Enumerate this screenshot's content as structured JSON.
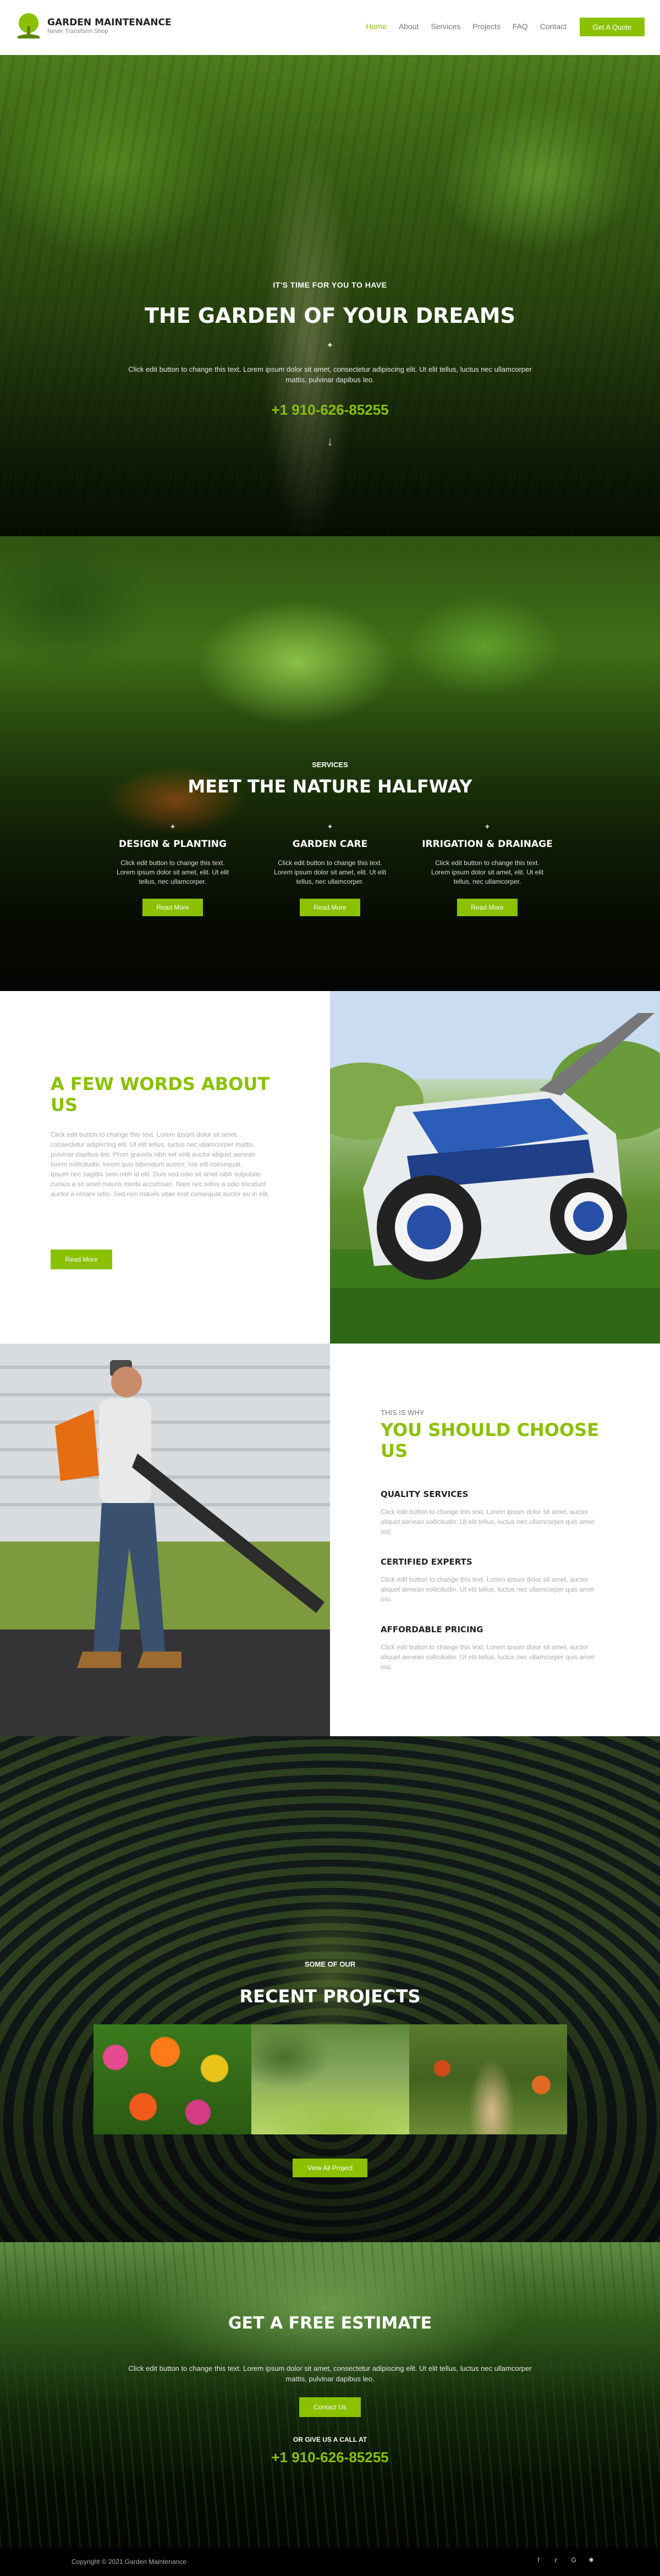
{
  "brand": {
    "name": "GARDEN MAINTENANCE",
    "tagline": "Never Transform Shop",
    "accent_color": "#8ac100",
    "logo_icon": "tree-icon"
  },
  "nav": {
    "items": [
      {
        "label": "Home",
        "active": true
      },
      {
        "label": "About",
        "active": false
      },
      {
        "label": "Services",
        "active": false
      },
      {
        "label": "Projects",
        "active": false
      },
      {
        "label": "FAQ",
        "active": false
      },
      {
        "label": "Contact",
        "active": false
      }
    ],
    "cta_label": "Get A Quote"
  },
  "hero": {
    "pre_title": "IT'S TIME FOR YOU TO HAVE",
    "title": "THE GARDEN OF YOUR DREAMS",
    "description": "Click edit button to change this text. Lorem ipsum dolor sit amet, consectetur adipiscing elit. Ut elit tellus, luctus nec ullamcorper mattis, pulvinar dapibus leo.",
    "phone": "+1 910-626-85255"
  },
  "services": {
    "pre_title": "SERVICES",
    "title": "MEET THE NATURE HALFWAY",
    "items": [
      {
        "title": "DESIGN & PLANTING",
        "text": "Click edit button to change this text. Lorem ipsum dolor sit amet, elit. Ut elit tellus, nec ullamcorper.",
        "button": "Read More"
      },
      {
        "title": "GARDEN CARE",
        "text": "Click edit button to change this text. Lorem ipsum dolor sit amet, elit. Ut elit tellus, nec ullamcorper.",
        "button": "Read More"
      },
      {
        "title": "IRRIGATION & DRAINAGE",
        "text": "Click edit button to change this text. Lorem ipsum dolor sit amet, elit. Ut elit tellus, nec ullamcorper.",
        "button": "Read More"
      }
    ]
  },
  "about": {
    "title": "A FEW WORDS ABOUT US",
    "paragraph_1": "Click edit button to change this text. Lorem ipsum dolor sit amet, consectetur adipiscing elit. Ut elit tellus, luctus nec ullamcorper mattis, pulvinar dapibus leo. Proin gravida nibh vel velit auctor aliquet aenean lorem sollicitudin, lorem quis bibendum auctor, nisi elit consequat.",
    "paragraph_2": "Ipsum nec sagittis sem nibh id elit. Duis sed odio sit amet nibh vulputate cursus a sit amet mauris morbi accumsan. Nam nec tellus a odio tincidunt auctor a ornare odio. Sed non mauris vitae erat consequat auctor eu in elit.",
    "button": "Read More"
  },
  "why": {
    "pre_title": "THIS IS WHY",
    "title": "YOU SHOULD CHOOSE US",
    "items": [
      {
        "title": "QUALITY SERVICES",
        "text": "Click edit button to change this text. Lorem ipsum dolor sit amet, auctor aliquet aenean sollicitudin. Ut elit tellus, luctus nec ullamcorper quis amet nisi."
      },
      {
        "title": "CERTIFIED EXPERTS",
        "text": "Click edit button to change this text. Lorem ipsum dolor sit amet, auctor aliquet aenean sollicitudin. Ut elit tellus, luctus nec ullamcorper quis amet nisi."
      },
      {
        "title": "AFFORDABLE PRICING",
        "text": "Click edit button to change this text. Lorem ipsum dolor sit amet, auctor aliquet aenean sollicitudin. Ut elit tellus, luctus nec ullamcorper quis amet nisi."
      }
    ]
  },
  "projects": {
    "pre_title": "SOME OF OUR",
    "title": "RECENT PROJECTS",
    "button": "View All Project"
  },
  "estimate": {
    "title": "GET A FREE ESTIMATE",
    "description": "Click edit button to change this text. Lorem ipsum dolor sit amet, consectetur adipiscing elit. Ut elit tellus, luctus nec ullamcorper mattis, pulvinar dapibus leo.",
    "button": "Contact Us",
    "or_call": "OR GIVE US A CALL AT",
    "phone": "+1 910-626-85255"
  },
  "footer": {
    "copyright": "Copyright © 2021 Garden Maintenance",
    "socials": [
      "facebook-icon",
      "twitter-icon",
      "google-icon",
      "yelp-icon"
    ]
  }
}
